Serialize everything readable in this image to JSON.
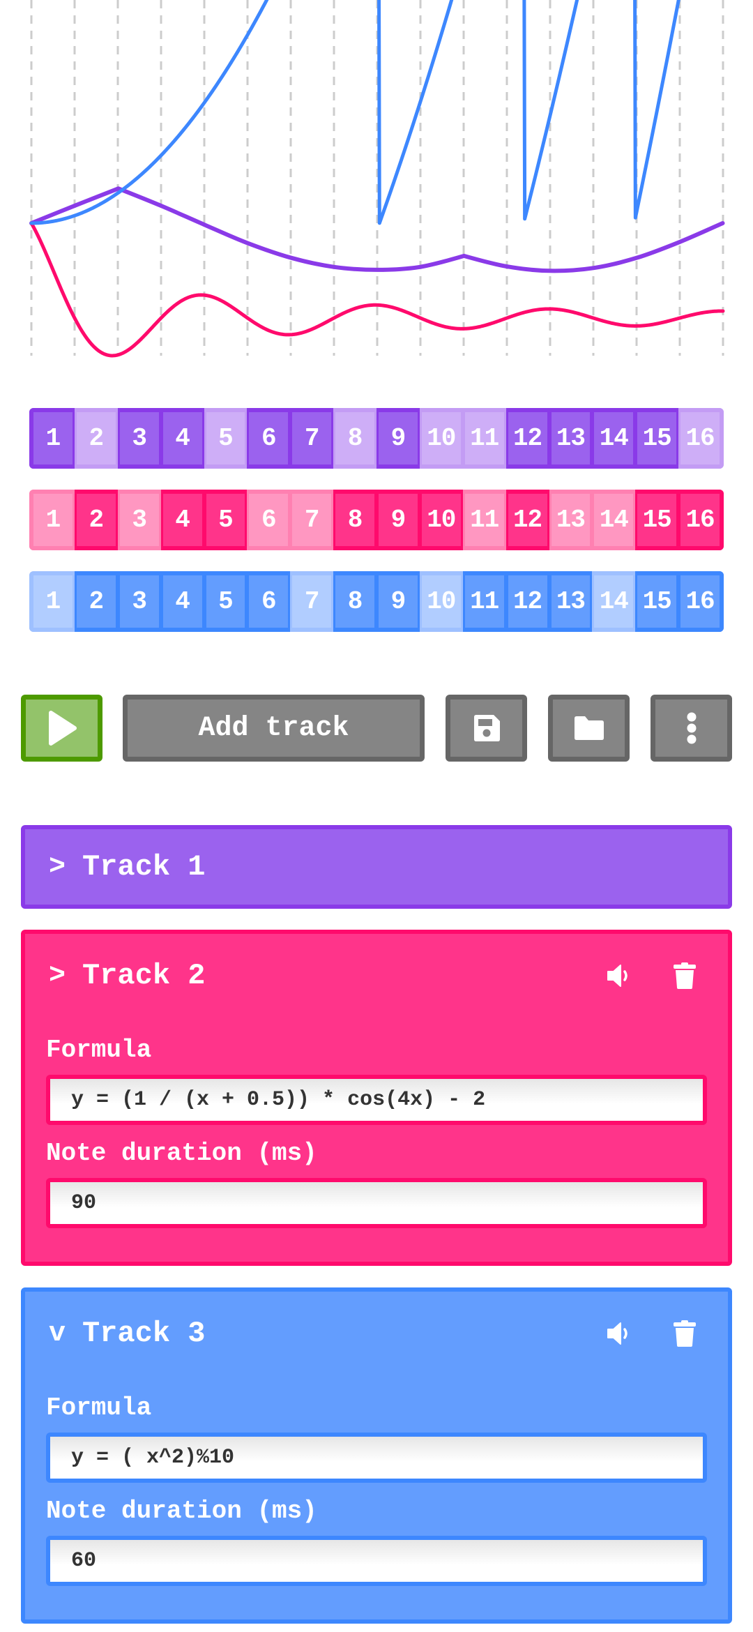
{
  "colors": {
    "purple": "#8a3ae8",
    "purple_fill": "#9b62ee",
    "purple_light": "#ceaef7",
    "purple_light_border": "#c39cf4",
    "pink": "#ff0a6c",
    "pink_fill": "#ff348a",
    "pink_light": "#ff97c1",
    "pink_light_border": "#ff80b1",
    "blue": "#3d87fe",
    "blue_fill": "#639dfe",
    "blue_light": "#b1cdff",
    "blue_light_border": "#9ec0ff",
    "grid": "#cccccc"
  },
  "chart_data": {
    "type": "line",
    "title": "",
    "xlabel": "",
    "ylabel": "",
    "xlim": [
      0,
      6.2832
    ],
    "grid": "vertical dashed, 16 steps",
    "series": [
      {
        "name": "Track 1",
        "color": "#8a3ae8",
        "formula": "",
        "x": [
          0,
          0.39,
          0.79,
          1.18,
          1.57,
          1.96,
          2.36,
          2.75,
          3.14,
          3.53,
          3.93,
          4.32,
          4.71,
          5.11,
          5.5,
          5.89,
          6.28
        ],
        "y_rel": [
          0,
          0.36,
          0.72,
          0.36,
          -0.03,
          -0.41,
          -0.72,
          -0.91,
          -0.97,
          -0.91,
          -0.68,
          -0.9,
          -0.99,
          -0.93,
          -0.72,
          -0.39,
          0
        ]
      },
      {
        "name": "Track 2",
        "color": "#ff0a6c",
        "formula": "y = (1 / (x + 0.5)) * cos(4x) - 2"
      },
      {
        "name": "Track 3",
        "color": "#3d87fe",
        "formula": "y = ( x^2)%10"
      }
    ]
  },
  "steps": [
    {
      "track": "Track 1",
      "color_key": "purple",
      "active": [
        true,
        false,
        true,
        true,
        false,
        true,
        true,
        false,
        true,
        false,
        false,
        true,
        true,
        true,
        true,
        false
      ]
    },
    {
      "track": "Track 2",
      "color_key": "pink",
      "active": [
        false,
        true,
        false,
        true,
        true,
        false,
        false,
        true,
        true,
        true,
        false,
        true,
        false,
        false,
        true,
        true
      ]
    },
    {
      "track": "Track 3",
      "color_key": "blue",
      "active": [
        false,
        true,
        true,
        true,
        true,
        true,
        false,
        true,
        true,
        false,
        true,
        true,
        true,
        false,
        true,
        true
      ]
    }
  ],
  "step_labels": [
    "1",
    "2",
    "3",
    "4",
    "5",
    "6",
    "7",
    "8",
    "9",
    "10",
    "11",
    "12",
    "13",
    "14",
    "15",
    "16"
  ],
  "toolbar": {
    "play_icon": "play-icon",
    "add_track_label": "Add track",
    "save_icon": "floppy-disk-icon",
    "open_icon": "folder-icon",
    "more_icon": "vertical-ellipsis-icon"
  },
  "tracks": [
    {
      "name": "Track 1",
      "arrow": ">",
      "expanded": false
    },
    {
      "name": "Track 2",
      "arrow": ">",
      "expanded": true,
      "formula_label": "Formula",
      "formula": "y = (1 / (x + 0.5)) * cos(4x) - 2",
      "duration_label": "Note duration (ms)",
      "duration": "90",
      "icons": [
        "speaker-icon",
        "trash-icon"
      ]
    },
    {
      "name": "Track 3",
      "arrow": "v",
      "expanded": true,
      "formula_label": "Formula",
      "formula": "y = ( x^2)%10",
      "duration_label": "Note duration (ms)",
      "duration": "60",
      "icons": [
        "speaker-icon",
        "trash-icon"
      ]
    }
  ]
}
